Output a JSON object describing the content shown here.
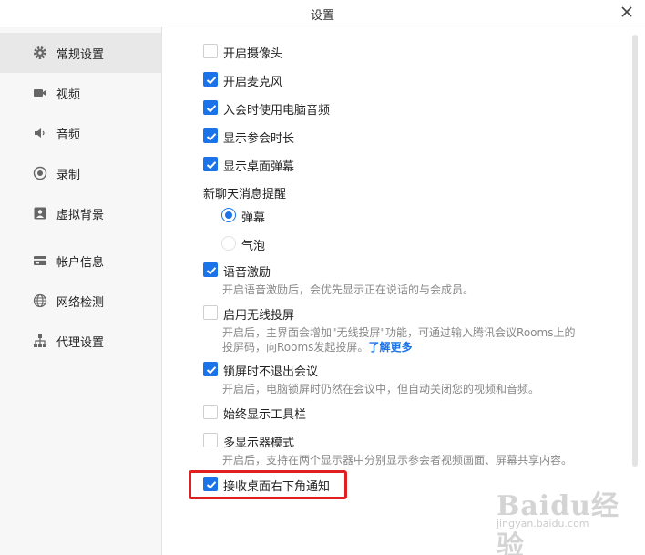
{
  "window": {
    "title": "设置"
  },
  "sidebar": {
    "items": [
      {
        "label": "常规设置",
        "icon": "gear-icon",
        "active": true
      },
      {
        "label": "视频",
        "icon": "video-camera-icon"
      },
      {
        "label": "音频",
        "icon": "speaker-icon"
      },
      {
        "label": "录制",
        "icon": "record-icon"
      },
      {
        "label": "虚拟背景",
        "icon": "portrait-icon"
      },
      {
        "label": "帐户信息",
        "icon": "card-icon"
      },
      {
        "label": "网络检测",
        "icon": "globe-icon"
      },
      {
        "label": "代理设置",
        "icon": "network-tree-icon"
      }
    ]
  },
  "settings": {
    "camera": {
      "label": "开启摄像头",
      "checked": false
    },
    "mic": {
      "label": "开启麦克风",
      "checked": true
    },
    "pc_audio": {
      "label": "入会时使用电脑音频",
      "checked": true
    },
    "show_duration": {
      "label": "显示参会时长",
      "checked": true
    },
    "desktop_danmaku": {
      "label": "显示桌面弹幕",
      "checked": true
    },
    "chat_notify": {
      "label": "新聊天消息提醒",
      "options": [
        {
          "label": "弹幕",
          "selected": true
        },
        {
          "label": "气泡",
          "selected": false
        }
      ]
    },
    "voice_incentive": {
      "label": "语音激励",
      "checked": true,
      "desc": "开启语音激励后，会优先显示正在说话的与会成员。"
    },
    "wireless_cast": {
      "label": "启用无线投屏",
      "checked": false,
      "desc": "开启后，主界面会增加\"无线投屏\"功能，可通过输入腾讯会议Rooms上的投屏码，向Rooms发起投屏。",
      "link": "了解更多"
    },
    "lock_screen": {
      "label": "锁屏时不退出会议",
      "checked": true,
      "desc": "开启后，电脑锁屏时仍然在会议中，但自动关闭您的视频和音频。"
    },
    "toolbar": {
      "label": "始终显示工具栏",
      "checked": false
    },
    "multi_display": {
      "label": "多显示器模式",
      "checked": false,
      "desc": "开启后，支持在两个显示器中分别显示参会者视频画面、屏幕共享内容。"
    },
    "desktop_notify": {
      "label": "接收桌面右下角通知",
      "checked": true
    }
  },
  "watermark": {
    "text": "Baidu经验",
    "sub": "jingyan.baidu.com"
  },
  "colors": {
    "accent": "#1a73e8",
    "highlight": "#e02020"
  }
}
